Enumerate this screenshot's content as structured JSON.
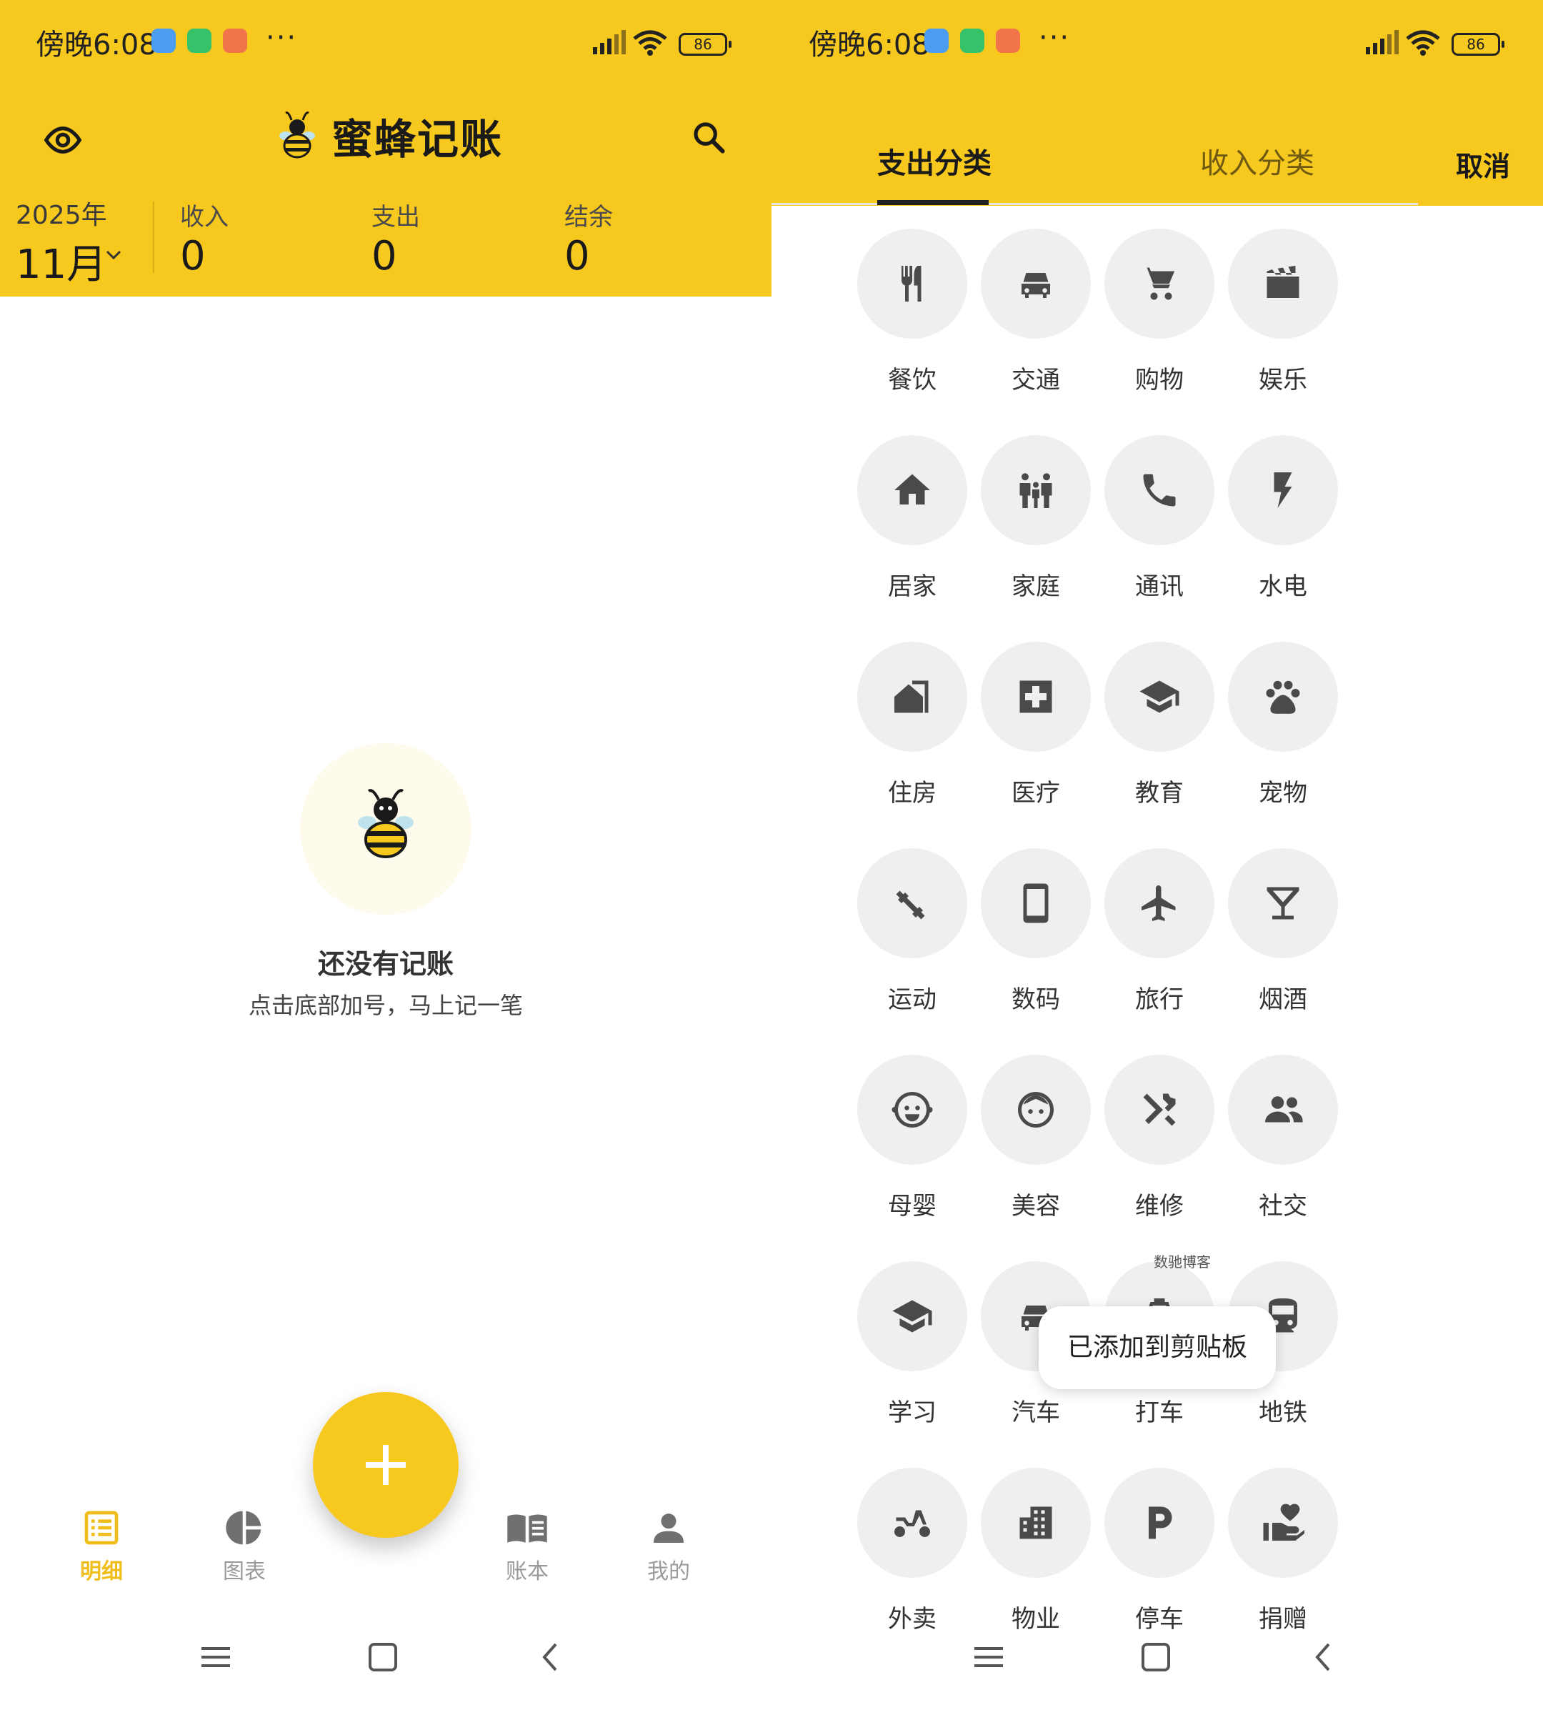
{
  "status_bar": {
    "time": "傍晚6:08",
    "dots": "···",
    "battery": "86"
  },
  "left": {
    "app_title": "蜜蜂记账",
    "year": "2025年",
    "month": "11月",
    "stats": [
      {
        "label": "收入",
        "value": "0"
      },
      {
        "label": "支出",
        "value": "0"
      },
      {
        "label": "结余",
        "value": "0"
      }
    ],
    "empty": {
      "title": "还没有记账",
      "subtitle": "点击底部加号，马上记一笔"
    },
    "nav": [
      {
        "label": "明细",
        "icon": "list-icon"
      },
      {
        "label": "图表",
        "icon": "pie-chart-icon"
      },
      {
        "label": "账本",
        "icon": "book-icon"
      },
      {
        "label": "我的",
        "icon": "person-icon"
      }
    ]
  },
  "right": {
    "tabs": [
      {
        "label": "支出分类"
      },
      {
        "label": "收入分类"
      }
    ],
    "cancel": "取消",
    "categories": [
      {
        "label": "餐饮",
        "icon": "restaurant-icon"
      },
      {
        "label": "交通",
        "icon": "car-icon"
      },
      {
        "label": "购物",
        "icon": "cart-icon"
      },
      {
        "label": "娱乐",
        "icon": "clapperboard-icon"
      },
      {
        "label": "居家",
        "icon": "home-icon"
      },
      {
        "label": "家庭",
        "icon": "family-icon"
      },
      {
        "label": "通讯",
        "icon": "phone-icon"
      },
      {
        "label": "水电",
        "icon": "bolt-icon"
      },
      {
        "label": "住房",
        "icon": "house-building-icon"
      },
      {
        "label": "医疗",
        "icon": "medical-icon"
      },
      {
        "label": "教育",
        "icon": "graduation-cap-icon"
      },
      {
        "label": "宠物",
        "icon": "paw-icon"
      },
      {
        "label": "运动",
        "icon": "dumbbell-icon"
      },
      {
        "label": "数码",
        "icon": "smartphone-icon"
      },
      {
        "label": "旅行",
        "icon": "airplane-icon"
      },
      {
        "label": "烟酒",
        "icon": "cocktail-icon"
      },
      {
        "label": "母婴",
        "icon": "baby-face-icon"
      },
      {
        "label": "美容",
        "icon": "face-icon"
      },
      {
        "label": "维修",
        "icon": "tools-icon"
      },
      {
        "label": "社交",
        "icon": "people-icon"
      },
      {
        "label": "学习",
        "icon": "graduation-cap-icon"
      },
      {
        "label": "汽车",
        "icon": "car-icon"
      },
      {
        "label": "打车",
        "icon": "taxi-icon"
      },
      {
        "label": "地铁",
        "icon": "subway-icon"
      },
      {
        "label": "外卖",
        "icon": "scooter-icon"
      },
      {
        "label": "物业",
        "icon": "building-icon"
      },
      {
        "label": "停车",
        "icon": "parking-icon"
      },
      {
        "label": "捐赠",
        "icon": "donate-icon"
      }
    ],
    "toast": "已添加到剪贴板",
    "watermark": "数驰博客"
  }
}
